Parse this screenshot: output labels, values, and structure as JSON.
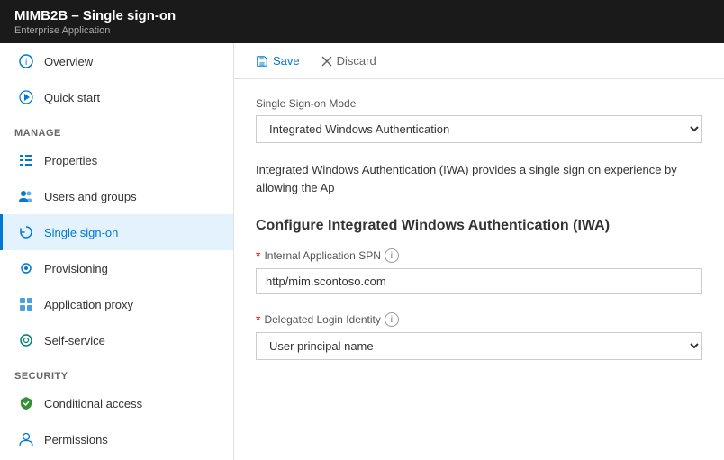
{
  "header": {
    "title": "MIMB2B – Single sign-on",
    "subtitle": "Enterprise Application"
  },
  "toolbar": {
    "save_label": "Save",
    "discard_label": "Discard"
  },
  "sidebar": {
    "items": [
      {
        "id": "overview",
        "label": "Overview",
        "icon": "ℹ",
        "iconColor": "icon-blue",
        "active": false
      },
      {
        "id": "quickstart",
        "label": "Quick start",
        "icon": "⚡",
        "iconColor": "icon-blue",
        "active": false
      }
    ],
    "manage_section": "MANAGE",
    "manage_items": [
      {
        "id": "properties",
        "label": "Properties",
        "icon": "≡",
        "iconColor": "icon-blue",
        "active": false
      },
      {
        "id": "users-groups",
        "label": "Users and groups",
        "icon": "👥",
        "iconColor": "icon-blue",
        "active": false
      },
      {
        "id": "single-sign-on",
        "label": "Single sign-on",
        "icon": "↻",
        "iconColor": "icon-blue",
        "active": true
      },
      {
        "id": "provisioning",
        "label": "Provisioning",
        "icon": "⚙",
        "iconColor": "icon-blue",
        "active": false
      },
      {
        "id": "application-proxy",
        "label": "Application proxy",
        "icon": "▦",
        "iconColor": "icon-blue",
        "active": false
      },
      {
        "id": "self-service",
        "label": "Self-service",
        "icon": "◎",
        "iconColor": "icon-teal",
        "active": false
      }
    ],
    "security_section": "SECURITY",
    "security_items": [
      {
        "id": "conditional-access",
        "label": "Conditional access",
        "icon": "🛡",
        "iconColor": "icon-green",
        "active": false
      },
      {
        "id": "permissions",
        "label": "Permissions",
        "icon": "👤",
        "iconColor": "icon-blue",
        "active": false
      }
    ]
  },
  "main": {
    "sso_mode_label": "Single Sign-on Mode",
    "sso_mode_value": "Integrated Windows Authentication",
    "description": "Integrated Windows Authentication (IWA) provides a single sign on experience by allowing the Ap",
    "configure_title": "Configure Integrated Windows Authentication (IWA)",
    "spn_label": "Internal Application SPN",
    "spn_value": "http/mim.scontoso.com",
    "login_identity_label": "Delegated Login Identity",
    "login_identity_value": "User principal name"
  }
}
